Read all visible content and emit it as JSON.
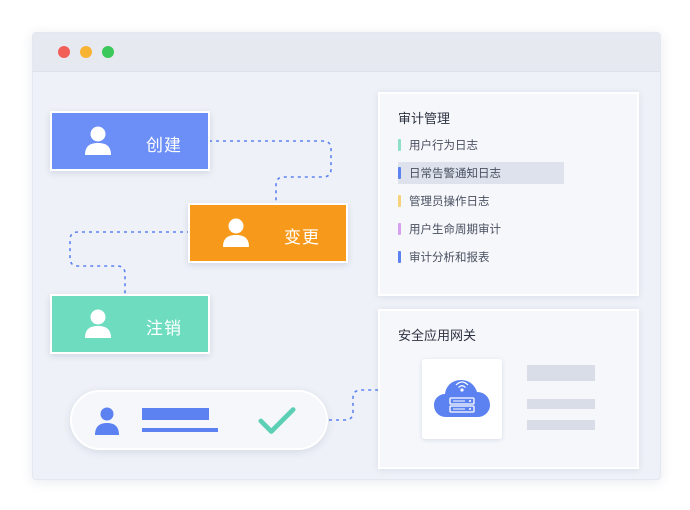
{
  "workflow": {
    "create_label": "创建",
    "change_label": "变更",
    "cancel_label": "注销"
  },
  "colors": {
    "create": "#6b8ef7",
    "change": "#f79a1b",
    "cancel": "#6ddcbf",
    "accent": "#5b82f0",
    "check": "#5ccfb4"
  },
  "audit": {
    "title": "审计管理",
    "items": [
      {
        "label": "用户行为日志",
        "color": "#8fe0c9"
      },
      {
        "label": "日常告警通知日志",
        "color": "#5b82f0",
        "selected": true
      },
      {
        "label": "管理员操作日志",
        "color": "#f7d27a"
      },
      {
        "label": "用户生命周期审计",
        "color": "#d6a0ee"
      },
      {
        "label": "审计分析和报表",
        "color": "#5b82f0"
      }
    ]
  },
  "gateway": {
    "title": "安全应用网关",
    "icon": "cloud-server-icon"
  },
  "window": {
    "buttons": [
      "close",
      "minimize",
      "maximize"
    ],
    "button_colors": [
      "#f25f58",
      "#f9b332",
      "#3cc85a"
    ]
  }
}
